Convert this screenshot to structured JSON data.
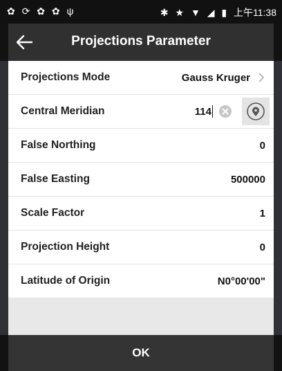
{
  "status_bar": {
    "left_icons": [
      "notification-icon",
      "sync-icon",
      "notification-icon",
      "notification-icon",
      "usb-icon"
    ],
    "right_icons": [
      "bluetooth-icon",
      "star-icon",
      "wifi-icon",
      "signal-icon",
      "battery-icon"
    ],
    "time": "上午11:38"
  },
  "header": {
    "title": "Projections Parameter"
  },
  "rows": [
    {
      "label": "Projections Mode",
      "value": "Gauss Kruger"
    },
    {
      "label": "Central Meridian",
      "value": "114"
    },
    {
      "label": "False Northing",
      "value": "0"
    },
    {
      "label": "False Easting",
      "value": "500000"
    },
    {
      "label": "Scale Factor",
      "value": "1"
    },
    {
      "label": "Projection Height",
      "value": "0"
    },
    {
      "label": "Latitude of Origin",
      "value": "N0°00'00\""
    }
  ],
  "footer": {
    "ok_label": "OK"
  },
  "colors": {
    "title_bar": "#303030",
    "ok_bar": "#343434",
    "background": "#e8e8e8"
  }
}
